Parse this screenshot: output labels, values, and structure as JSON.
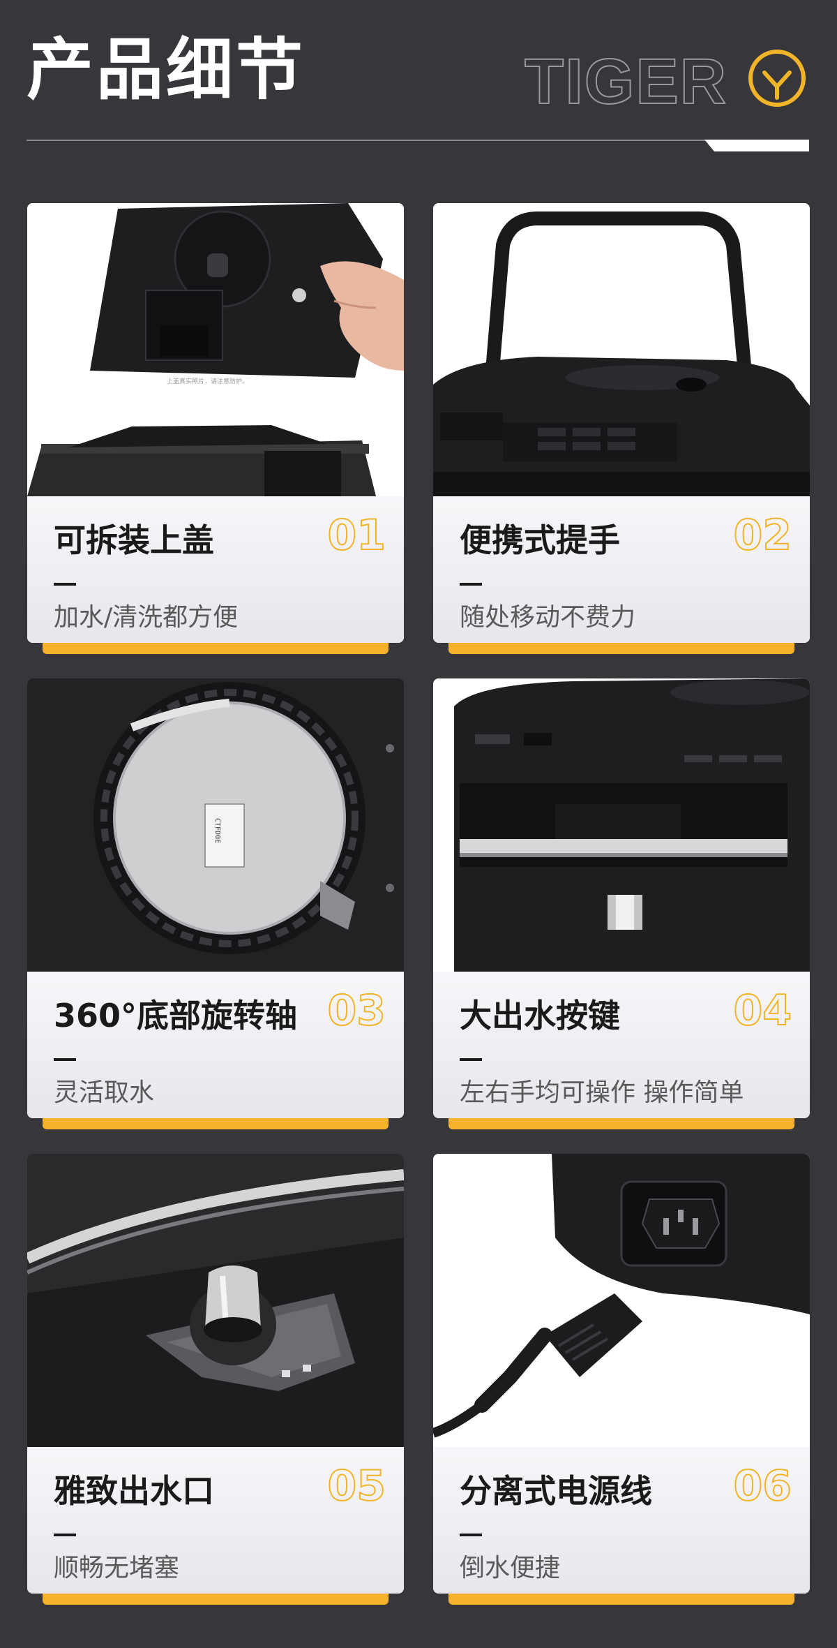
{
  "header": {
    "title": "产品细节",
    "brand": "TIGER",
    "brand_color": "#f0b428"
  },
  "cards": [
    {
      "title": "可拆装上盖",
      "number": "01",
      "subtitle": "加水/清洗都方便",
      "photo_label": "上盖真实照片，请注意防护。"
    },
    {
      "title": "便携式提手",
      "number": "02",
      "subtitle": "随处移动不费力"
    },
    {
      "title": "360°底部旋转轴",
      "number": "03",
      "subtitle": "灵活取水",
      "photo_label": "CTFD0E"
    },
    {
      "title": "大出水按键",
      "number": "04",
      "subtitle": "左右手均可操作 操作简单"
    },
    {
      "title": "雅致出水口",
      "number": "05",
      "subtitle": "顺畅无堵塞"
    },
    {
      "title": "分离式电源线",
      "number": "06",
      "subtitle": "倒水便捷"
    }
  ],
  "colors": {
    "background": "#37373b",
    "accent": "#f5b22a",
    "product": "#1c1c1e"
  }
}
